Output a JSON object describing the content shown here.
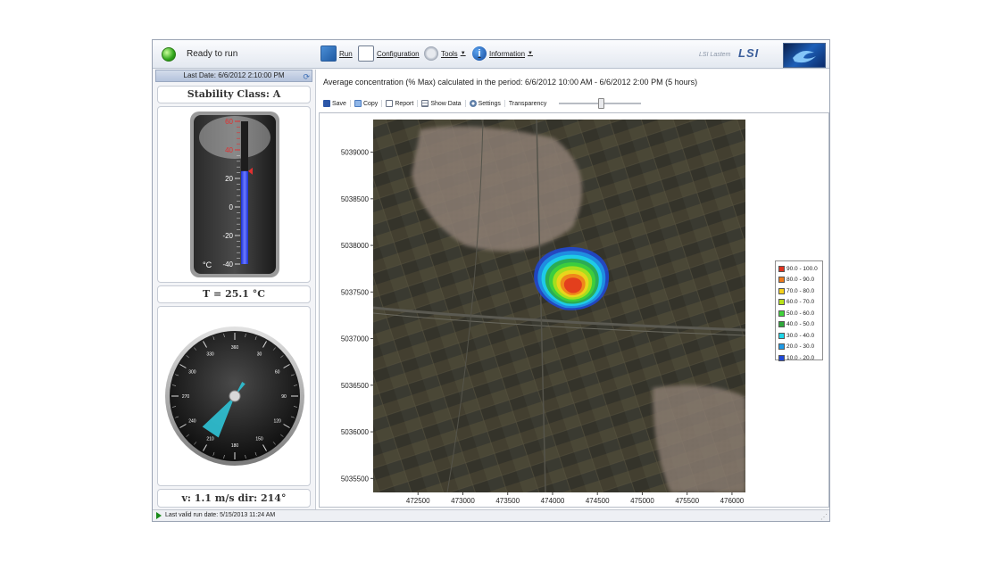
{
  "status": {
    "text": "Ready to run"
  },
  "toolbar": {
    "run_label": "Run",
    "configuration_label": "Configuration",
    "tools_label": "Tools",
    "information_label": "Information",
    "logo_small": "LSI Lastem",
    "logo_brand": "LSI"
  },
  "left": {
    "last_date": "Last Date: 6/6/2012 2:10:00 PM",
    "stability": "Stability Class: A",
    "thermometer": {
      "ticks": [
        "60",
        "40",
        "20",
        "0",
        "-20",
        "-40"
      ],
      "unit": "°C",
      "value": 25.1,
      "min": -40,
      "max": 60
    },
    "temperature_text": "T = 25.1 °C",
    "compass": {
      "labels": [
        "360",
        "30",
        "60",
        "90",
        "120",
        "150",
        "180",
        "210",
        "240",
        "270",
        "300",
        "330"
      ],
      "wind_dir_deg": 214
    },
    "wind_text": "v: 1.1 m/s dir: 214°"
  },
  "main": {
    "period_text": "Average concentration (% Max) calculated in the period: 6/6/2012 10:00 AM - 6/6/2012 2:00 PM (5 hours)",
    "tools": {
      "save": "Save",
      "copy": "Copy",
      "report": "Report",
      "show_data": "Show Data",
      "settings": "Settings",
      "transparency": "Transparency"
    },
    "transparency_value": 0.5
  },
  "chart_data": {
    "type": "heatmap",
    "x_ticks": [
      472500,
      473000,
      473500,
      474000,
      474500,
      475000,
      475500,
      476000
    ],
    "y_ticks": [
      5035500,
      5036000,
      5036500,
      5037000,
      5037500,
      5038000,
      5038500,
      5039000
    ],
    "xlim": [
      472000,
      476150
    ],
    "ylim": [
      5035350,
      5039350
    ],
    "legend": [
      {
        "label": "90.0 - 100.0",
        "color": "#e0321e"
      },
      {
        "label": "80.0 - 90.0",
        "color": "#f07a1a"
      },
      {
        "label": "70.0 - 80.0",
        "color": "#f6d21c"
      },
      {
        "label": "60.0 - 70.0",
        "color": "#b8e218"
      },
      {
        "label": "50.0 - 60.0",
        "color": "#3fd43a"
      },
      {
        "label": "40.0 - 50.0",
        "color": "#2ea73a"
      },
      {
        "label": "30.0 - 40.0",
        "color": "#1fd6e8"
      },
      {
        "label": "20.0 - 30.0",
        "color": "#1e9ae6"
      },
      {
        "label": "10.0 - 20.0",
        "color": "#1f49d8"
      }
    ],
    "plume": {
      "peak_x": 474230,
      "peak_y": 5037570,
      "levels": [
        10,
        20,
        30,
        40,
        50,
        60,
        70,
        80,
        90
      ]
    }
  },
  "statusbar": {
    "text": "Last valid run date: 5/15/2013 11:24 AM"
  }
}
